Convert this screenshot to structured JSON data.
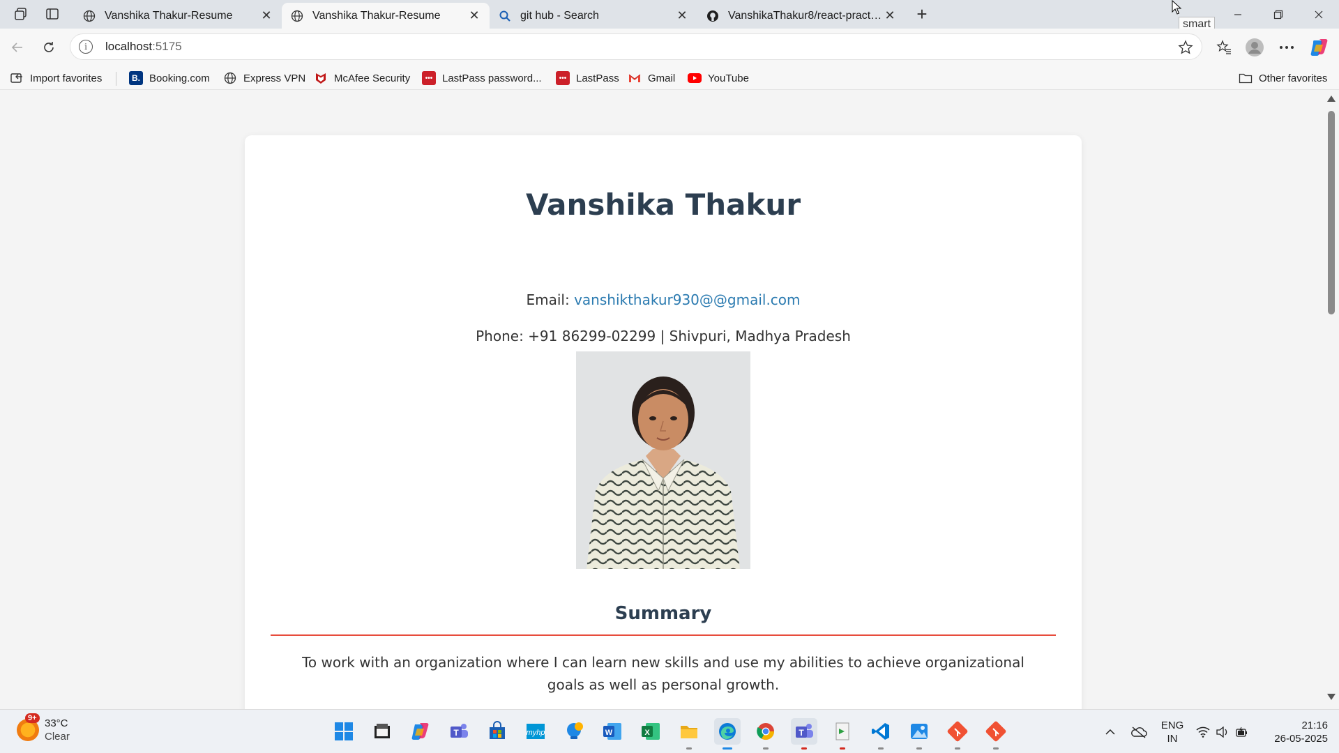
{
  "browser": {
    "tabs": [
      {
        "title": "Vanshika Thakur-Resume",
        "active": false,
        "icon": "globe-icon"
      },
      {
        "title": "Vanshika Thakur-Resume",
        "active": true,
        "icon": "globe-icon"
      },
      {
        "title": "git hub - Search",
        "active": false,
        "icon": "search-icon"
      },
      {
        "title": "VanshikaThakur8/react-practice",
        "active": false,
        "icon": "github-icon"
      }
    ],
    "tooltip": "smart",
    "address": {
      "host": "localhost",
      "port": ":5175"
    },
    "favorites": [
      {
        "label": "Import favorites",
        "icon": "import-icon"
      },
      {
        "label": "Booking.com",
        "icon": "booking-icon",
        "icon_text": "B.",
        "color": "#003580"
      },
      {
        "label": "Express VPN",
        "icon": "globe-icon"
      },
      {
        "label": "McAfee Security",
        "icon": "mcafee-icon",
        "color": "#c01818"
      },
      {
        "label": "LastPass password...",
        "icon": "lastpass-icon",
        "icon_text": "•••",
        "color": "#cc2029"
      },
      {
        "label": "LastPass",
        "icon": "lastpass-icon",
        "icon_text": "•••",
        "color": "#cc2029"
      },
      {
        "label": "Gmail",
        "icon": "gmail-icon"
      },
      {
        "label": "YouTube",
        "icon": "youtube-icon",
        "color": "#ff0000"
      }
    ],
    "other_favorites": "Other favorites"
  },
  "resume": {
    "name": "Vanshika Thakur",
    "email_label": "Email: ",
    "email": "vanshikthakur930@@gmail.com",
    "phone_line": "Phone: +91 86299-02299 | Shivpuri, Madhya Pradesh",
    "summary_title": "Summary",
    "summary_text": "To work with an organization where I can learn new skills and use my abilities to achieve organizational goals as well as personal growth.",
    "accent_color": "#e74c3c",
    "heading_color": "#2c3e50",
    "link_color": "#2a7ab0"
  },
  "taskbar": {
    "weather_badge": "9+",
    "temperature": "33°C",
    "condition": "Clear",
    "apps": [
      "start-icon",
      "file-explorer-icon",
      "copilot-icon",
      "teams-icon",
      "store-icon",
      "hp-icon",
      "tips-icon",
      "word-icon",
      "excel-icon",
      "folder-icon",
      "edge-icon",
      "chrome-icon",
      "teams-work-icon",
      "installer-icon",
      "vscode-icon",
      "photos-icon",
      "git-icon",
      "git-gui-icon"
    ],
    "lang_top": "ENG",
    "lang_bottom": "IN",
    "time": "21:16",
    "date": "26-05-2025"
  }
}
